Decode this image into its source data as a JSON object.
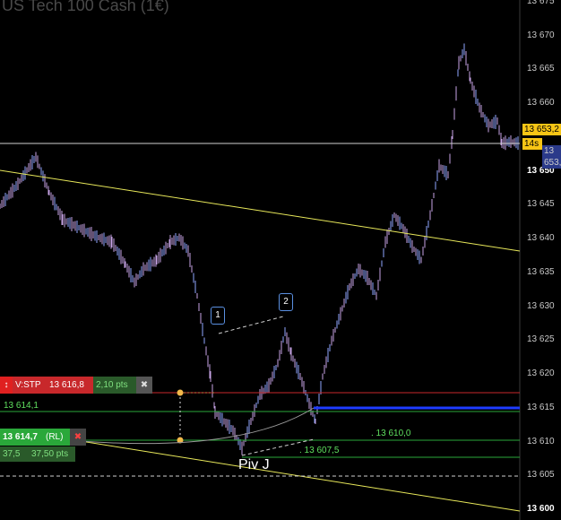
{
  "instrument": {
    "title": "US Tech 100 Cash (1€)"
  },
  "price_axis": {
    "labels": [
      {
        "text": "13 675",
        "value": 13675
      },
      {
        "text": "13 670",
        "value": 13670
      },
      {
        "text": "13 665",
        "value": 13665
      },
      {
        "text": "13 660",
        "value": 13660
      },
      {
        "text": "13 650",
        "value": 13650,
        "bold": true
      },
      {
        "text": "13 645",
        "value": 13645
      },
      {
        "text": "13 640",
        "value": 13640
      },
      {
        "text": "13 635",
        "value": 13635
      },
      {
        "text": "13 630",
        "value": 13630
      },
      {
        "text": "13 625",
        "value": 13625
      },
      {
        "text": "13 620",
        "value": 13620
      },
      {
        "text": "13 615",
        "value": 13615
      },
      {
        "text": "13 610",
        "value": 13610
      },
      {
        "text": "13 605",
        "value": 13605
      },
      {
        "text": "13 600",
        "value": 13600,
        "bold": true
      }
    ],
    "current_price_label": "13 653,2",
    "secondary_price_label": "13 653,2",
    "countdown": "14s"
  },
  "stop_order": {
    "type_label": "V:STP",
    "price": "13 616,8",
    "distance": "2,10 pts",
    "close_icon": "x-icon"
  },
  "limit_order": {
    "price": "13 614,7",
    "tag": "(RL)",
    "size": "37,5",
    "pts": "37,50 pts",
    "close_icon": "x-icon"
  },
  "line_labels": {
    "green_level": "13 614,1",
    "level_1": ". 13 610,0",
    "level_2": ". 13 607,5"
  },
  "annotations": {
    "point_1": "1",
    "point_2": "2",
    "pivot": "Piv J"
  },
  "colors": {
    "background": "#000000",
    "candle": "#c7a4e6",
    "candle_up": "#8fa6ff",
    "trendline": "#e8e85a",
    "stop_red": "#c8282b",
    "limit_green": "#2aa83a",
    "blue_line": "#1e3cff",
    "current_price_bg": "#f7c515"
  }
}
